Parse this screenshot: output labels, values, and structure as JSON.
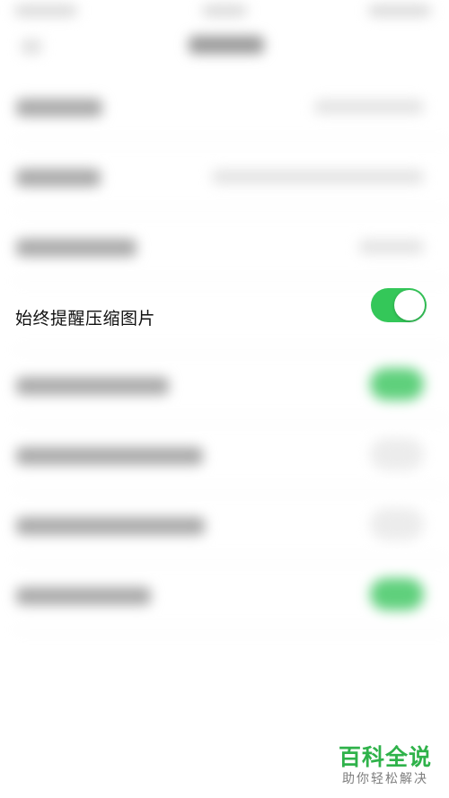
{
  "settings": {
    "focused_item": {
      "label": "始终提醒压缩图片",
      "toggle_on": true
    }
  },
  "watermark": {
    "title": "百科全说",
    "subtitle": "助你轻松解决"
  },
  "colors": {
    "switch_on": "#34c759",
    "watermark_green": "#2fb24a",
    "watermark_gray": "#7d7d7d"
  }
}
